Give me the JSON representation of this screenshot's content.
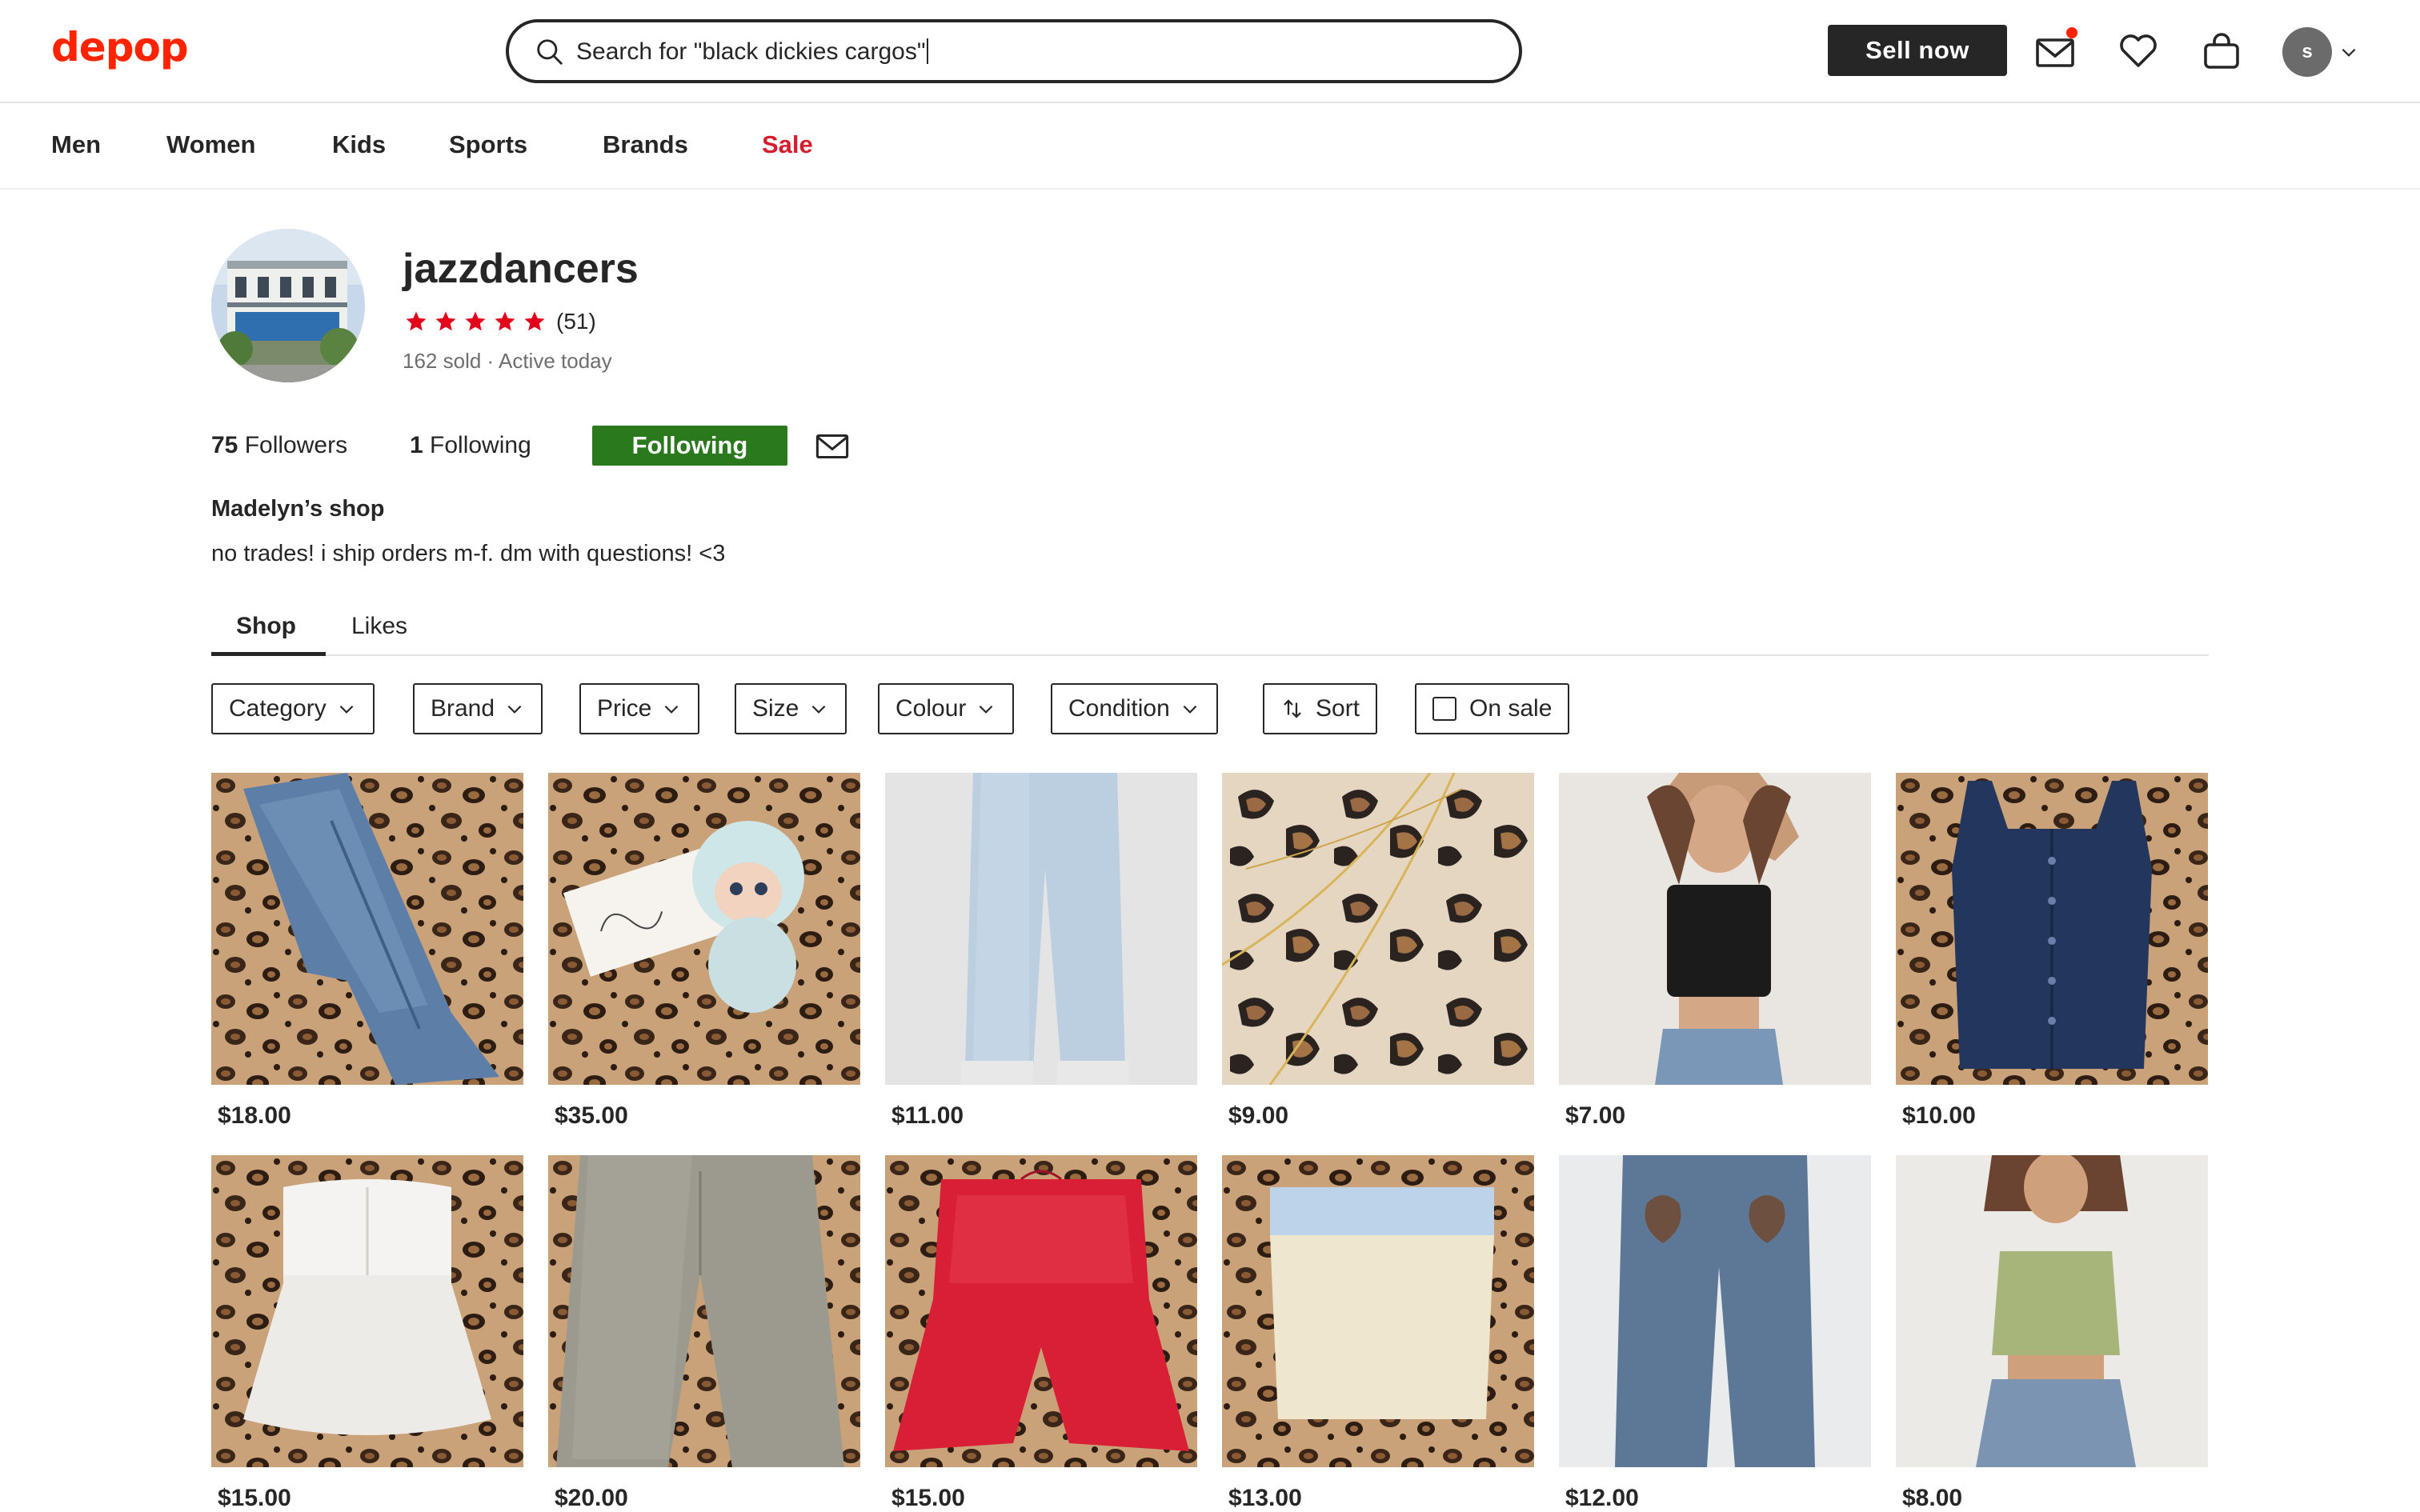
{
  "header": {
    "logo": "depop",
    "search": {
      "text": "Search for \"black dickies cargos\""
    },
    "sell_label": "Sell now",
    "avatar_initial": "s",
    "accent_color": "#ff2300"
  },
  "nav": {
    "items": [
      "Men",
      "Women",
      "Kids",
      "Sports",
      "Brands"
    ],
    "sale_label": "Sale"
  },
  "profile": {
    "username": "jazzdancers",
    "rating": 5,
    "review_count": "(51)",
    "sold": "162 sold",
    "separator": " · ",
    "activity": "Active today",
    "followers_count": "75",
    "followers_label": "Followers",
    "following_count": "1",
    "following_label": "Following",
    "follow_button": "Following",
    "follow_button_color": "#2a7a1d",
    "shop_name": "Madelyn’s shop",
    "bio": "no trades! i ship orders m-f. dm with questions! <3"
  },
  "tabs": [
    "Shop",
    "Likes"
  ],
  "active_tab": "Shop",
  "filters": {
    "category": "Category",
    "brand": "Brand",
    "price": "Price",
    "size": "Size",
    "colour": "Colour",
    "condition": "Condition",
    "sort": "Sort",
    "on_sale": "On sale"
  },
  "products": [
    {
      "price": "$18.00",
      "item": "jeans"
    },
    {
      "price": "$35.00",
      "item": "plush keychain"
    },
    {
      "price": "$11.00",
      "item": "light blue sweatpants"
    },
    {
      "price": "$9.00",
      "item": "gold chain necklace"
    },
    {
      "price": "$7.00",
      "item": "black tank top"
    },
    {
      "price": "$10.00",
      "item": "navy button tank"
    },
    {
      "price": "$15.00",
      "item": "white babydoll top"
    },
    {
      "price": "$20.00",
      "item": "grey trousers"
    },
    {
      "price": "$15.00",
      "item": "red shorts"
    },
    {
      "price": "$13.00",
      "item": "cream tube top"
    },
    {
      "price": "$12.00",
      "item": "heart pocket jeans"
    },
    {
      "price": "$8.00",
      "item": "green halter top"
    }
  ]
}
